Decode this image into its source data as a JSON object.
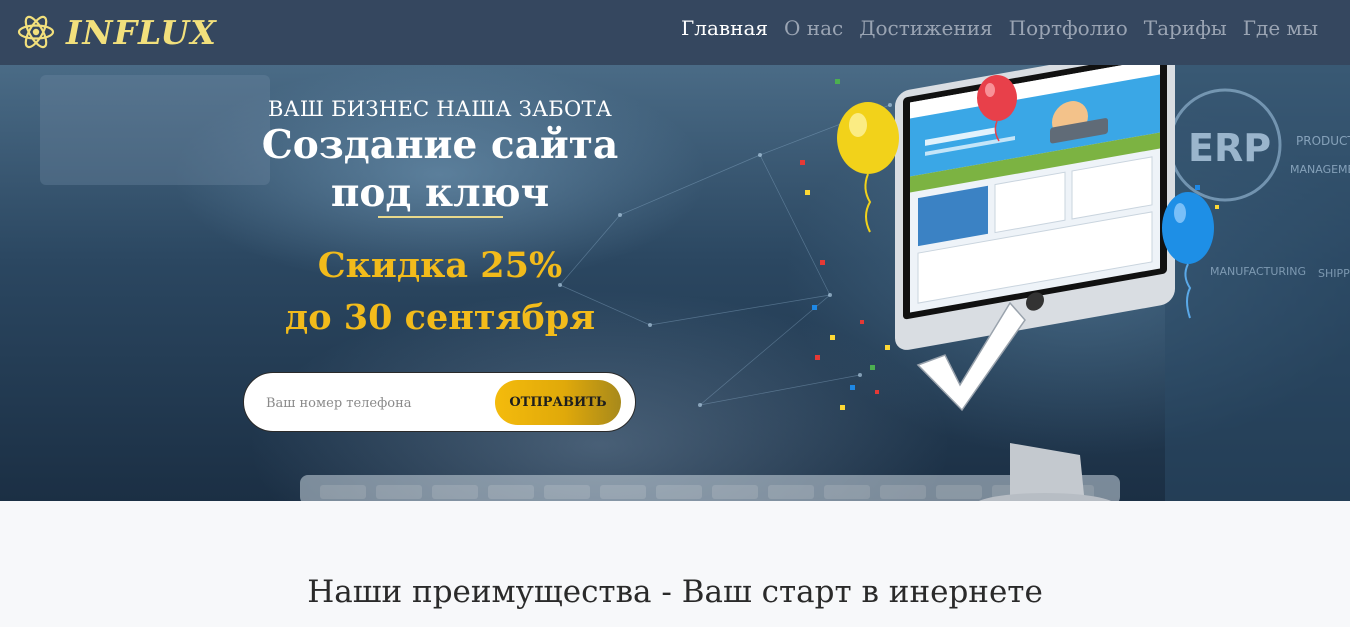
{
  "brand": {
    "name": "INFLUX",
    "logo_icon": "atom-icon",
    "colors": {
      "nav_bg": "#35475f",
      "logo": "#f2e07c",
      "accent": "#f2bb1b"
    }
  },
  "nav": {
    "items": [
      {
        "label": "Главная",
        "active": true
      },
      {
        "label": "О нас",
        "active": false
      },
      {
        "label": "Достижения",
        "active": false
      },
      {
        "label": "Портфолио",
        "active": false
      },
      {
        "label": "Тарифы",
        "active": false
      },
      {
        "label": "Где мы",
        "active": false
      }
    ]
  },
  "hero": {
    "tagline": "ВАШ БИЗНЕС НАША ЗАБОТА",
    "title_line1": "Создание сайта",
    "title_line2": "под ключ",
    "discount_line1": "Скидка 25%",
    "discount_line2": "до 30 сентября",
    "illustration": {
      "monitor_screen_icon": "website-mockup-icon",
      "brand_icon": "apple-logo-icon",
      "check_icon": "checkmark-icon",
      "balloons": [
        "yellow-balloon-icon",
        "red-balloon-icon",
        "blue-balloon-icon"
      ]
    },
    "background_words": [
      "ERP",
      "PRODUCT",
      "MANAGEMENT",
      "MANUFACTURING",
      "SHIPP"
    ]
  },
  "form": {
    "phone_placeholder": "Ваш номер телефона",
    "phone_value": "",
    "submit_label": "ОТПРАВИТЬ"
  },
  "section": {
    "title": "Наши преимущества - Ваш старт в инернете"
  }
}
